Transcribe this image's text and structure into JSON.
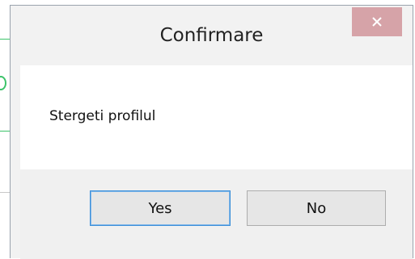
{
  "dialog": {
    "title": "Confirmare",
    "message": "Stergeti profilul",
    "close_icon": "close-icon",
    "buttons": {
      "yes_label": "Yes",
      "no_label": "No"
    }
  },
  "colors": {
    "close_button_bg": "#d6a3a8",
    "default_button_border": "#3b8fd9",
    "background_accent": "#3cc36a"
  }
}
